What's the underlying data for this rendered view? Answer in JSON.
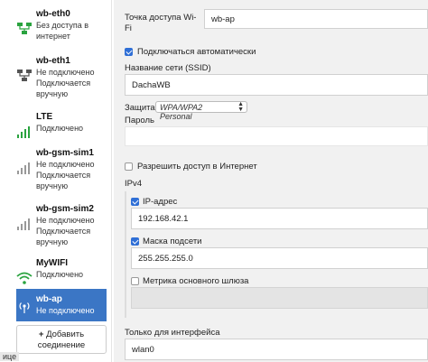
{
  "sidebar": {
    "connections": [
      {
        "name": "wb-eth0",
        "status": "Без доступа в\nинтернет",
        "icon": "ethernet-connected-icon",
        "active": false
      },
      {
        "name": "wb-eth1",
        "status": "Не подключено\nПодключается\nвручную",
        "icon": "ethernet-disconnected-icon",
        "active": false
      },
      {
        "name": "LTE",
        "status": "Подключено",
        "icon": "signal-bars-icon",
        "active": false
      },
      {
        "name": "wb-gsm-sim1",
        "status": "Не подключено\nПодключается\nвручную",
        "icon": "signal-bars-empty-icon",
        "active": false
      },
      {
        "name": "wb-gsm-sim2",
        "status": "Не подключено\nПодключается\nвручную",
        "icon": "signal-bars-empty-icon",
        "active": false
      },
      {
        "name": "MyWIFI",
        "status": "Подключено",
        "icon": "wifi-icon",
        "active": false
      },
      {
        "name": "wb-ap",
        "status": "Не подключено",
        "icon": "access-point-icon",
        "active": true
      }
    ],
    "add_button_line1": "Добавить",
    "add_button_line2": "соединение",
    "clipped_label": "ице"
  },
  "form": {
    "ap_label_line1": "Точка доступа Wi-",
    "ap_label_line2": "Fi",
    "ap_value": "wb-ap",
    "auto_connect_label": "Подключаться автоматически",
    "ssid_label": "Название сети (SSID)",
    "ssid_value": "DachaWB",
    "security_label": "Защита",
    "security_value": "WPA/WPA2 Personal",
    "password_label": "Пароль",
    "password_value": "",
    "internet_access_label": "Разрешить доступ в Интернет",
    "ipv4_label": "IPv4",
    "ip_label": "IP-адрес",
    "ip_value": "192.168.42.1",
    "mask_label": "Маска подсети",
    "mask_value": "255.255.255.0",
    "gateway_metric_label": "Метрика основного шлюза",
    "gateway_metric_value": "",
    "interface_only_label": "Только для интерфейса",
    "interface_value": "wlan0"
  },
  "colors": {
    "active_bg": "#3b76c5",
    "checkbox_on": "#2f6fd6",
    "signal_green": "#2aa33f"
  }
}
